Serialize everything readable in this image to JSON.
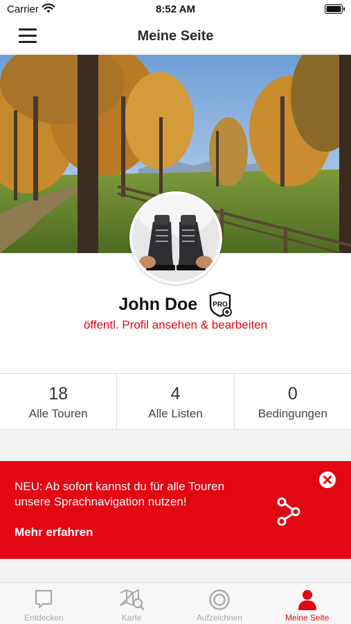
{
  "status_bar": {
    "carrier": "Carrier",
    "time": "8:52 AM"
  },
  "header": {
    "title": "Meine Seite"
  },
  "profile": {
    "name": "John Doe",
    "badge": "PRO",
    "link_text": "öffentl. Profil ansehen & bearbeiten"
  },
  "stats": [
    {
      "value": "18",
      "label": "Alle Touren"
    },
    {
      "value": "4",
      "label": "Alle Listen"
    },
    {
      "value": "0",
      "label": "Bedingungen"
    }
  ],
  "banner": {
    "text": "NEU: Ab sofort kannst du für alle Touren unsere Sprachnavigation nutzen!",
    "more": "Mehr erfahren"
  },
  "tabbar": [
    {
      "label": "Entdecken",
      "icon": "chat-bubble-icon",
      "active": false
    },
    {
      "label": "Karte",
      "icon": "map-search-icon",
      "active": false
    },
    {
      "label": "Aufzeichnen",
      "icon": "record-icon",
      "active": false
    },
    {
      "label": "Meine Seite",
      "icon": "user-icon",
      "active": true
    }
  ],
  "colors": {
    "accent": "#e30613",
    "inactive": "#a8a8a8"
  }
}
